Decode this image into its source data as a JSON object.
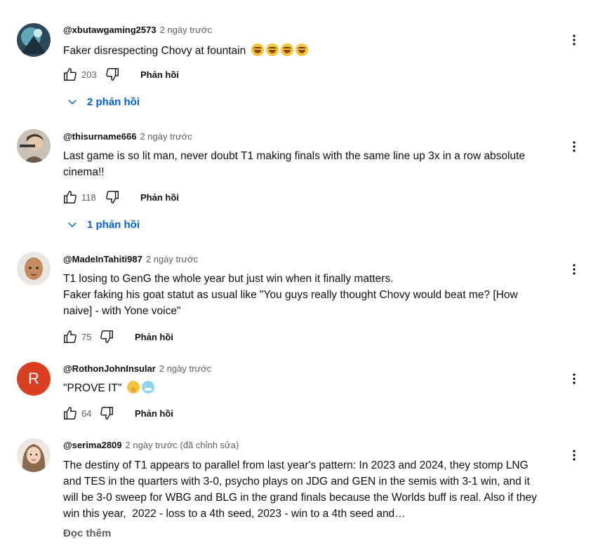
{
  "comments": [
    {
      "author": "@xbutawgaming2573",
      "time": "2 ngày trước",
      "lines": [
        "Faker disrespecting Chovy at fountain"
      ],
      "emojis": [
        "face-with-tears-of-joy",
        "face-with-tears-of-joy",
        "face-with-tears-of-joy",
        "face-with-tears-of-joy"
      ],
      "likes": "203",
      "reply_label": "Phản hồi",
      "replies_label": "2 phản hồi"
    },
    {
      "author": "@thisurname666",
      "time": "2 ngày trước",
      "lines": [
        "Last game is so lit man, never doubt T1 making finals with the same line up 3x in a row absolute",
        "cinema!!"
      ],
      "likes": "118",
      "reply_label": "Phản hồi",
      "replies_label": "1 phản hồi"
    },
    {
      "author": "@MadeInTahiti987",
      "time": "2 ngày trước",
      "lines": [
        "T1 losing to GenG the whole year but just win when it finally matters.",
        "Faker faking his goat statut as usual like \"You guys really thought Chovy would beat me? [How",
        "naive] - with Yone voice\""
      ],
      "likes": "75",
      "reply_label": "Phản hồi"
    },
    {
      "author": "@RothonJohnInsular",
      "time": "2 ngày trước",
      "avatar_letter": "R",
      "lines": [
        "\"PROVE IT\""
      ],
      "emojis": [
        "shushing-face",
        "cold-face"
      ],
      "likes": "64",
      "reply_label": "Phản hồi"
    },
    {
      "author": "@serima2809",
      "time": "2 ngày trước (đã chỉnh sửa)",
      "lines": [
        "The destiny of T1 appears to parallel from last year's pattern: In 2023 and 2024, they stomp LNG",
        "and TES in the quarters with 3-0, psycho plays on JDG and GEN in the semis with 3-1 win, and it",
        "will be 3-0 sweep for WBG and BLG in the grand finals because the Worlds buff is real. Also if they",
        "win this year,  2022 - loss to a 4th seed, 2023 - win to a 4th seed and…"
      ],
      "read_more": "Đọc thêm"
    }
  ],
  "colors": {
    "link_blue": "#065fd4",
    "secondary_text": "#606060",
    "avatar_r": "#d93f21"
  },
  "icons": [
    "like-icon",
    "dislike-icon",
    "chevron-down-icon",
    "more-vert-icon"
  ]
}
